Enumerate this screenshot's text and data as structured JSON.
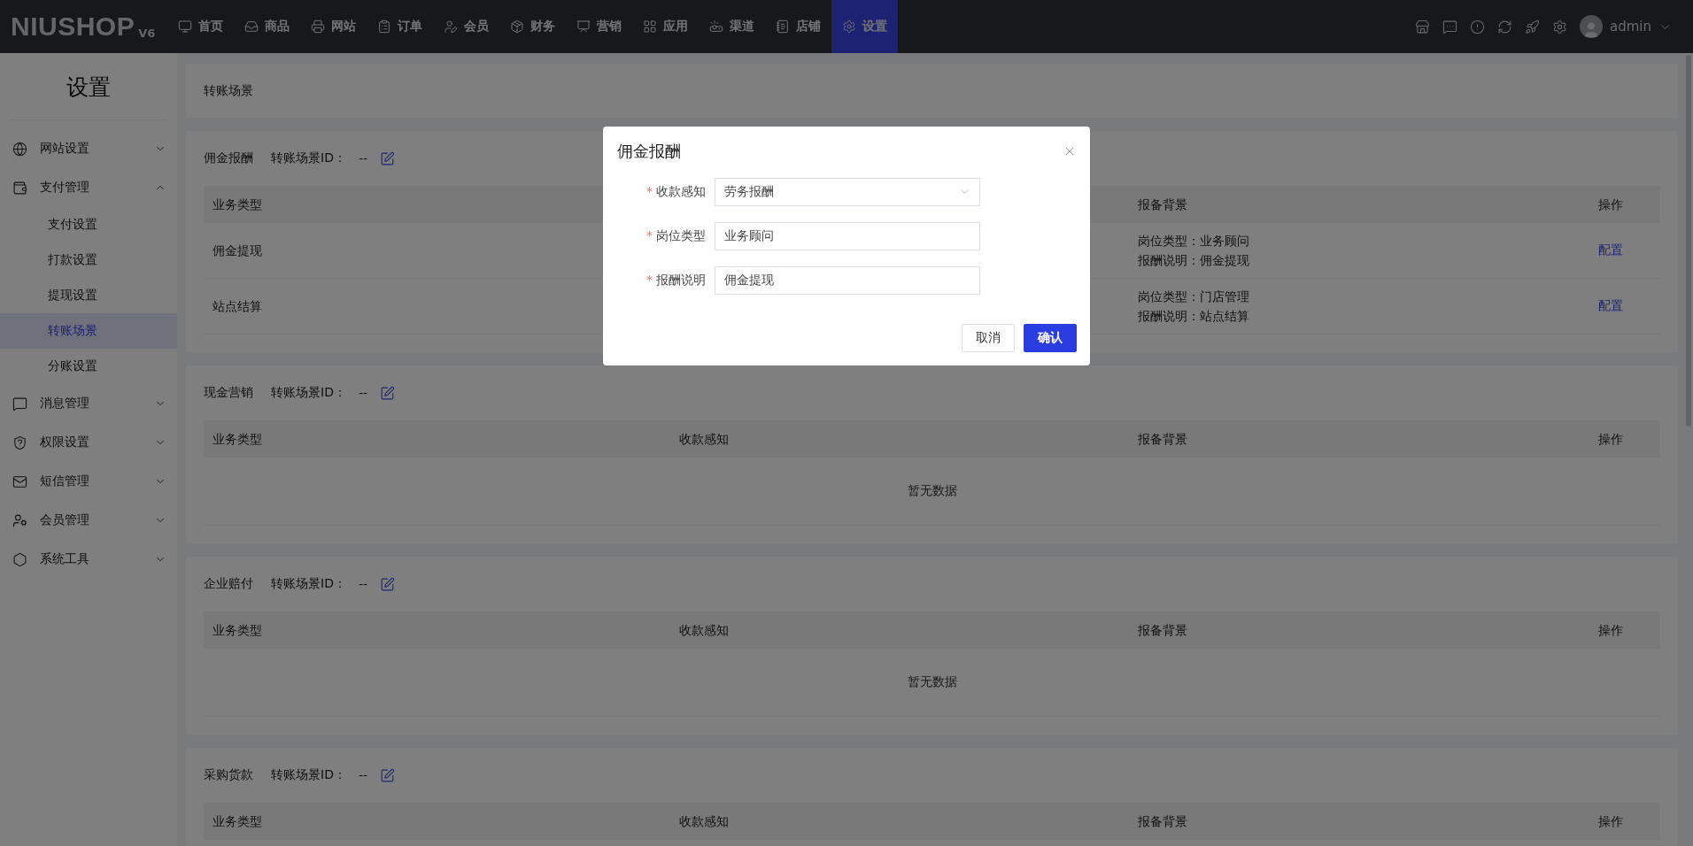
{
  "topbar": {
    "logo": "NIUSHOP",
    "logo_version": "V6",
    "nav": [
      {
        "label": "首页",
        "selected": false
      },
      {
        "label": "商品",
        "selected": false
      },
      {
        "label": "网站",
        "selected": false
      },
      {
        "label": "订单",
        "selected": false
      },
      {
        "label": "会员",
        "selected": false
      },
      {
        "label": "财务",
        "selected": false
      },
      {
        "label": "营销",
        "selected": false
      },
      {
        "label": "应用",
        "selected": false
      },
      {
        "label": "渠道",
        "selected": false
      },
      {
        "label": "店铺",
        "selected": false
      },
      {
        "label": "设置",
        "selected": true
      }
    ],
    "user": "admin"
  },
  "sidebar": {
    "title": "设置",
    "items": [
      {
        "label": "网站设置",
        "selected": false,
        "expanded": false
      },
      {
        "label": "支付管理",
        "selected": false,
        "expanded": true,
        "children": [
          {
            "label": "支付设置",
            "selected": false
          },
          {
            "label": "打款设置",
            "selected": false
          },
          {
            "label": "提现设置",
            "selected": false
          },
          {
            "label": "转账场景",
            "selected": true
          },
          {
            "label": "分账设置",
            "selected": false
          }
        ]
      },
      {
        "label": "消息管理",
        "selected": false,
        "expanded": false
      },
      {
        "label": "权限设置",
        "selected": false,
        "expanded": false
      },
      {
        "label": "短信管理",
        "selected": false,
        "expanded": false
      },
      {
        "label": "会员管理",
        "selected": false,
        "expanded": false
      },
      {
        "label": "系统工具",
        "selected": false,
        "expanded": false
      }
    ]
  },
  "page_title": "转账场景",
  "sections": [
    {
      "title": "佣金报酬",
      "id_label": "转账场景ID：",
      "id_value": "--",
      "columns": [
        "业务类型",
        "报备背景",
        "操作"
      ],
      "rows": [
        {
          "business_type": "佣金提现",
          "background": [
            "岗位类型：业务顾问",
            "报酬说明：佣金提现"
          ],
          "action": "配置"
        },
        {
          "business_type": "站点结算",
          "background": [
            "岗位类型：门店管理",
            "报酬说明：站点结算"
          ],
          "action": "配置"
        }
      ]
    },
    {
      "title": "现金营销",
      "id_label": "转账场景ID：",
      "id_value": "--",
      "columns": [
        "业务类型",
        "收款感知",
        "报备背景",
        "操作"
      ],
      "empty_text": "暂无数据"
    },
    {
      "title": "企业赔付",
      "id_label": "转账场景ID：",
      "id_value": "--",
      "columns": [
        "业务类型",
        "收款感知",
        "报备背景",
        "操作"
      ],
      "empty_text": "暂无数据"
    },
    {
      "title": "采购货款",
      "id_label": "转账场景ID：",
      "id_value": "--",
      "columns": [
        "业务类型",
        "收款感知",
        "报备背景",
        "操作"
      ]
    }
  ],
  "dialog": {
    "title": "佣金报酬",
    "required_mark": "*",
    "fields": [
      {
        "kind": "select",
        "label": "收款感知",
        "required": true,
        "value": "劳务报酬"
      },
      {
        "kind": "input",
        "label": "岗位类型",
        "required": true,
        "value": "业务顾问"
      },
      {
        "kind": "input",
        "label": "报酬说明",
        "required": true,
        "value": "佣金提现"
      }
    ],
    "buttons": [
      {
        "label": "取消",
        "kind": "default"
      },
      {
        "label": "确认",
        "kind": "primary"
      }
    ]
  }
}
